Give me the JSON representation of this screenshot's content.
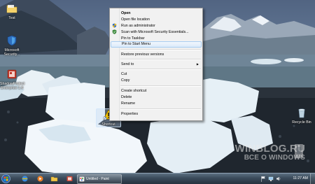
{
  "desktop": {
    "icons": [
      {
        "name": "test-folder",
        "label": "Test",
        "icon": "folder-icon"
      },
      {
        "name": "microsoft-security",
        "label": "Microsoft Security...",
        "icon": "shield-icon"
      },
      {
        "name": "shadow-protect",
        "label": "ShadowProtect Enterprise 1.0",
        "icon": "app-icon"
      },
      {
        "name": "shortcut",
        "label": "Shortcut",
        "icon": "warning-icon"
      },
      {
        "name": "recycle-bin",
        "label": "Recycle Bin",
        "icon": "recycle-bin-icon"
      }
    ]
  },
  "context_menu": {
    "items": [
      {
        "label": "Open",
        "bold": true
      },
      {
        "label": "Open file location"
      },
      {
        "label": "Run as administrator",
        "icon": "uac-shield-icon"
      },
      {
        "label": "Scan with Microsoft Security Essentials...",
        "icon": "mse-icon"
      },
      {
        "label": "Pin to Taskbar"
      },
      {
        "label": "Pin to Start Menu",
        "highlighted": true
      },
      {
        "label": "Restore previous versions"
      },
      {
        "label": "Send to",
        "submenu": true
      },
      {
        "label": "Cut"
      },
      {
        "label": "Copy"
      },
      {
        "label": "Create shortcut"
      },
      {
        "label": "Delete"
      },
      {
        "label": "Rename"
      },
      {
        "label": "Properties"
      }
    ]
  },
  "taskbar": {
    "start_icon": "windows-orb-icon",
    "pinned": [
      "explorer-icon",
      "media-player-icon",
      "folder-icon",
      "app-icon"
    ],
    "window_button": "Untitled - Paint",
    "tray": [
      "flag-icon",
      "network-icon",
      "volume-icon"
    ],
    "clock": "11:27 AM"
  },
  "watermark": {
    "line1": "WINBLOG.RU",
    "line2": "ВСЕ О WINDOWS"
  },
  "colors": {
    "menu_bg": "#f1f1f1",
    "menu_highlight": "#dbeafa",
    "taskbar": "#2f3d4b"
  }
}
